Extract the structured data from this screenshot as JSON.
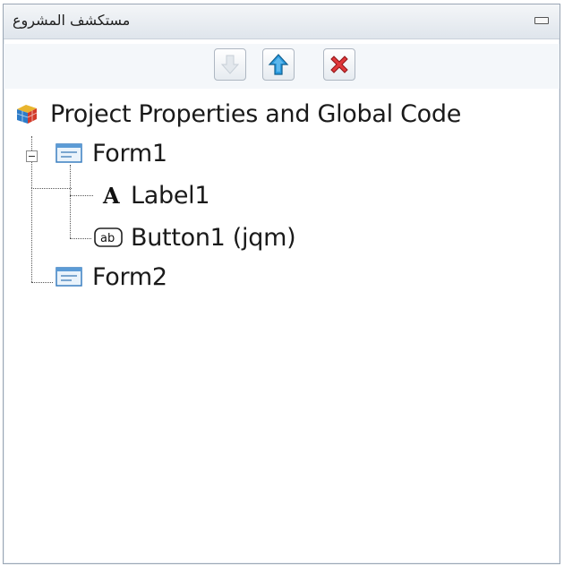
{
  "window": {
    "title": "مستكشف المشروع"
  },
  "toolbar": {
    "buttons": [
      {
        "icon": "move-down-icon",
        "enabled": false
      },
      {
        "icon": "move-up-icon",
        "enabled": true
      },
      {
        "icon": "delete-icon",
        "enabled": true
      }
    ]
  },
  "tree": {
    "root": {
      "label": "Project Properties and Global Code",
      "icon": "project-cube-icon"
    },
    "form1": {
      "label": "Form1",
      "icon": "form-icon",
      "expanded": true
    },
    "label1": {
      "label": "Label1",
      "icon": "label-a-icon"
    },
    "button1": {
      "label": "Button1 (jqm)",
      "icon": "button-ab-icon"
    },
    "form2": {
      "label": "Form2",
      "icon": "form-icon"
    }
  },
  "colors": {
    "accent_blue": "#1e8fd6",
    "delete_red": "#d6262b",
    "border": "#9aa6b4"
  }
}
